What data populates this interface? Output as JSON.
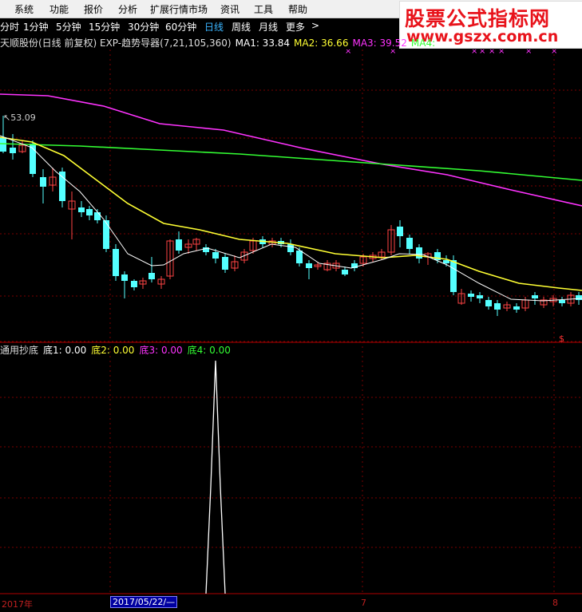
{
  "menu": {
    "items": [
      "系统",
      "功能",
      "报价",
      "分析",
      "扩展行情市场",
      "资讯",
      "工具",
      "帮助"
    ]
  },
  "watermark": {
    "title": "股票公式指标网",
    "url": "www.gszx.com.cn"
  },
  "periods": {
    "items": [
      "分时",
      "1分钟",
      "5分钟",
      "15分钟",
      "30分钟",
      "60分钟",
      "日线",
      "周线",
      "月线",
      "更多",
      ">"
    ],
    "active": "日线"
  },
  "info": {
    "stock_title": "天顺股份(日线 前复权) EXP-趋势导器(7,21,105,360)",
    "ma1": "MA1: 33.84",
    "ma2": "MA2: 36.66",
    "ma3": "MA3: 39.52",
    "ma4": "MA4: "
  },
  "price_label": "53.09",
  "indicator": {
    "title": "通用抄底",
    "d1": "底1: 0.00",
    "d2": "底2: 0.00",
    "d3": "底3: 0.00",
    "d4": "底4: 0.00"
  },
  "dates": {
    "year_label": "2017年",
    "cursor_date": "2017/05/22/—",
    "month7": "7",
    "month8": "8"
  },
  "colors": {
    "up": "#ff4444",
    "down": "#54ffff",
    "ma1": "#ffffff",
    "ma2": "#ffff33",
    "ma3": "#ff33ff",
    "ma4": "#33ff33",
    "grid": "#7a0000",
    "active_period": "#3ab5ff",
    "cursor_bg": "#0000a0"
  }
}
